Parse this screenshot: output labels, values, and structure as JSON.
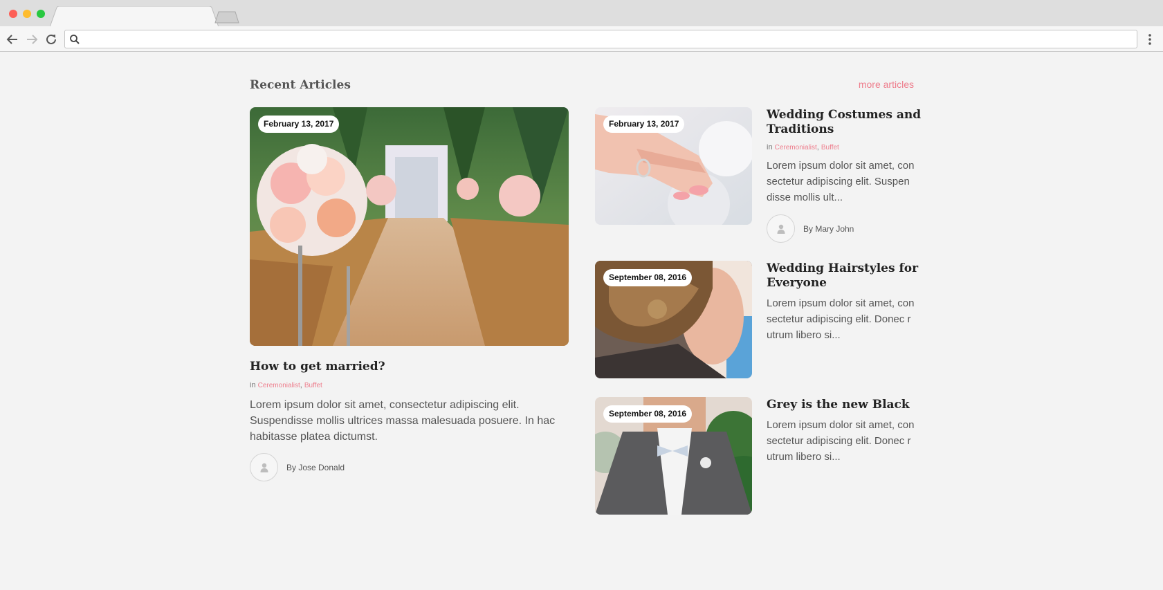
{
  "browser": {
    "address_value": "",
    "icons": [
      "back-arrow-icon",
      "forward-arrow-icon",
      "reload-icon",
      "search-icon",
      "kebab-menu-icon"
    ]
  },
  "section": {
    "title": "Recent Articles",
    "more_link": "more articles"
  },
  "featured": {
    "date": "February 13, 2017",
    "title": "How to get married?",
    "in_label": "in",
    "categories": [
      "Ceremonialist",
      "Buffet"
    ],
    "excerpt": "Lorem ipsum dolor sit amet, consectetur adipiscing elit. Suspendisse mollis ultrices massa malesuada posuere. In hac habitasse platea dictumst.",
    "author": "By Jose Donald"
  },
  "side_articles": [
    {
      "date": "February 13, 2017",
      "title": "Wedding Costumes and Traditions",
      "in_label": "in",
      "categories": [
        "Ceremonialist",
        "Buffet"
      ],
      "excerpt": "Lorem ipsum dolor sit amet, consectetur adipiscing elit. Suspendisse mollis ult...",
      "author": "By Mary John"
    },
    {
      "date": "September 08, 2016",
      "title": "Wedding Hairstyles for Everyone",
      "excerpt": "Lorem ipsum dolor sit amet, consectetur adipiscing elit. Donec rutrum libero si..."
    },
    {
      "date": "September 08, 2016",
      "title": "Grey is the new Black",
      "excerpt": "Lorem ipsum dolor sit amet, consectetur adipiscing elit. Donec rutrum libero si..."
    }
  ],
  "colors": {
    "accent": "#ee7d8c",
    "page_bg": "#f3f3f3",
    "heading": "#222222",
    "body_text": "#555555"
  }
}
